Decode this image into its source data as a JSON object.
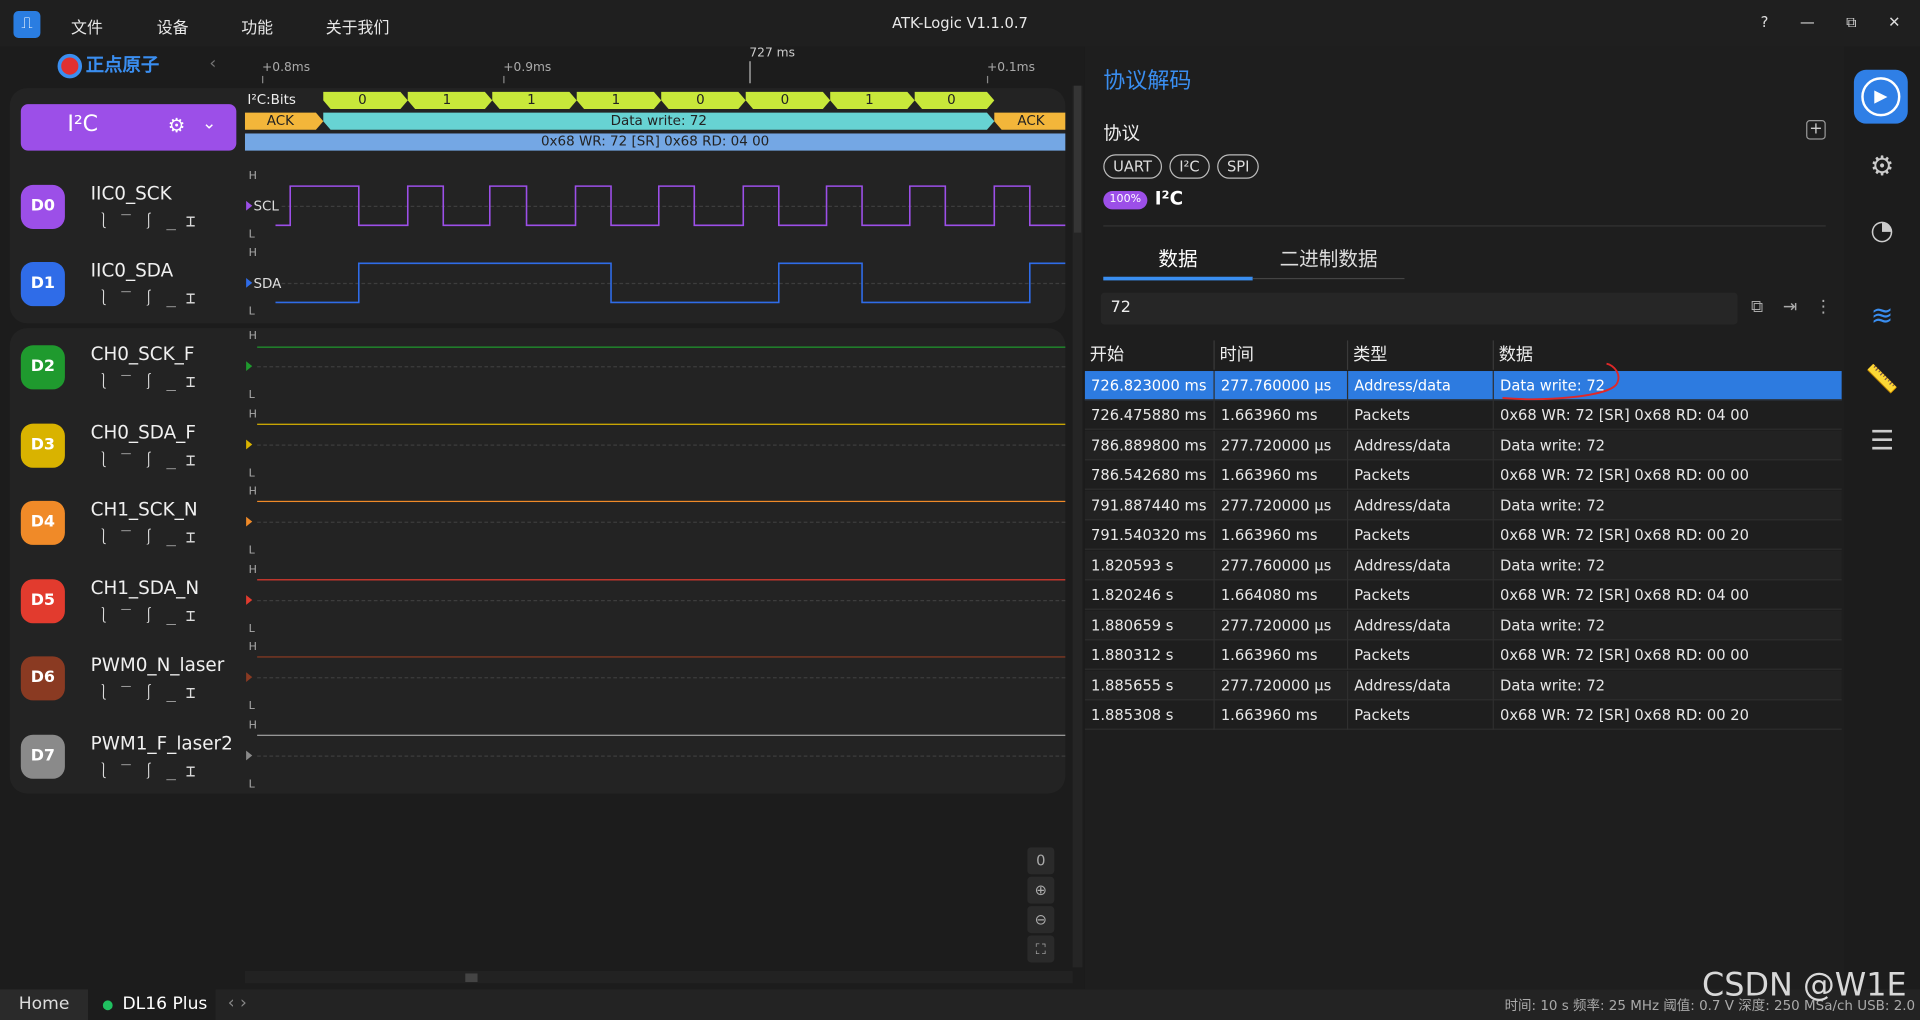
{
  "app": {
    "title": "ATK-Logic  V1.1.0.7",
    "logo_glyph": "⎍"
  },
  "menu": [
    "文件",
    "设备",
    "功能",
    "关于我们"
  ],
  "window_controls": [
    "?",
    "—",
    "⧉",
    "✕"
  ],
  "brand": {
    "name": "正点原子",
    "collapse_glyph": "‹"
  },
  "ruler": {
    "labels": [
      "+0.8ms",
      "+0.9ms",
      "+0.1ms"
    ],
    "cursor": "727 ms"
  },
  "i2c_group": {
    "label": "I²C",
    "gear": "⚙",
    "chevron": "⌄"
  },
  "decode": {
    "bits_label": "I²C:Bits",
    "bits": [
      "0",
      "1",
      "1",
      "1",
      "0",
      "0",
      "1",
      "0"
    ],
    "ack_left": "ACK",
    "data_write": "Data write: 72",
    "ack_right": "ACK",
    "packet": "0x68 WR: 72 [SR] 0x68 RD: 04 00"
  },
  "channels": [
    {
      "id": "D0",
      "name": "IIC0_SCK",
      "color": "#9c4fe8",
      "tag": "SCL"
    },
    {
      "id": "D1",
      "name": "IIC0_SDA",
      "color": "#2f6ce8",
      "tag": "SDA"
    },
    {
      "id": "D2",
      "name": "CH0_SCK_F",
      "color": "#1f9a2e"
    },
    {
      "id": "D3",
      "name": "CH0_SDA_F",
      "color": "#d9b300"
    },
    {
      "id": "D4",
      "name": "CH1_SCK_N",
      "color": "#f08a28"
    },
    {
      "id": "D5",
      "name": "CH1_SDA_N",
      "color": "#e23b2e"
    },
    {
      "id": "D6",
      "name": "PWM0_N_laser",
      "color": "#8a3a22"
    },
    {
      "id": "D7",
      "name": "PWM1_F_laser2",
      "color": "#8a8a8a"
    }
  ],
  "trigger_glyphs": "⎱‾⎰_⌶",
  "level_labels": {
    "high": "H",
    "low": "L"
  },
  "zoom_tools": [
    "0",
    "⊕",
    "⊖",
    "⛶"
  ],
  "panel": {
    "title": "协议解码",
    "protocol_label": "协议",
    "add_glyph": "+",
    "chips": [
      "UART",
      "I²C",
      "SPI"
    ],
    "percent": "100%",
    "protocol_name": "I²C",
    "tabs": [
      "数据",
      "二进制数据"
    ],
    "search_value": "72",
    "search_icons": [
      "⧉",
      "⇥",
      "⋮"
    ]
  },
  "table": {
    "headers": [
      "开始",
      "时间",
      "类型",
      "数据"
    ],
    "rows": [
      [
        "726.823000 ms",
        "277.760000 µs",
        "Address/data",
        "Data write: 72"
      ],
      [
        "726.475880 ms",
        "1.663960 ms",
        "Packets",
        "0x68 WR: 72 [SR] 0x68 RD: 04 00"
      ],
      [
        "786.889800 ms",
        "277.720000 µs",
        "Address/data",
        "Data write: 72"
      ],
      [
        "786.542680 ms",
        "1.663960 ms",
        "Packets",
        "0x68 WR: 72 [SR] 0x68 RD: 00 00"
      ],
      [
        "791.887440 ms",
        "277.720000 µs",
        "Address/data",
        "Data write: 72"
      ],
      [
        "791.540320 ms",
        "1.663960 ms",
        "Packets",
        "0x68 WR: 72 [SR] 0x68 RD: 00 20"
      ],
      [
        "1.820593 s",
        "277.760000 µs",
        "Address/data",
        "Data write: 72"
      ],
      [
        "1.820246 s",
        "1.664080 ms",
        "Packets",
        "0x68 WR: 72 [SR] 0x68 RD: 04 00"
      ],
      [
        "1.880659 s",
        "277.720000 µs",
        "Address/data",
        "Data write: 72"
      ],
      [
        "1.880312 s",
        "1.663960 ms",
        "Packets",
        "0x68 WR: 72 [SR] 0x68 RD: 00 00"
      ],
      [
        "1.885655 s",
        "277.720000 µs",
        "Address/data",
        "Data write: 72"
      ],
      [
        "1.885308 s",
        "1.663960 ms",
        "Packets",
        "0x68 WR: 72 [SR] 0x68 RD: 00 20"
      ]
    ]
  },
  "sidebar_icons": [
    "⚙",
    "◔",
    "≋",
    "📏",
    "☰"
  ],
  "bottom": {
    "home": "Home",
    "device": "DL16 Plus",
    "nav": "‹ ›",
    "status": "时间: 10 s   频率: 25 MHz   阈值: 0.7 V   深度: 250 MSa/ch   USB: 2.0",
    "watermark": "CSDN @W1E"
  },
  "accent": "#2f7fe6"
}
